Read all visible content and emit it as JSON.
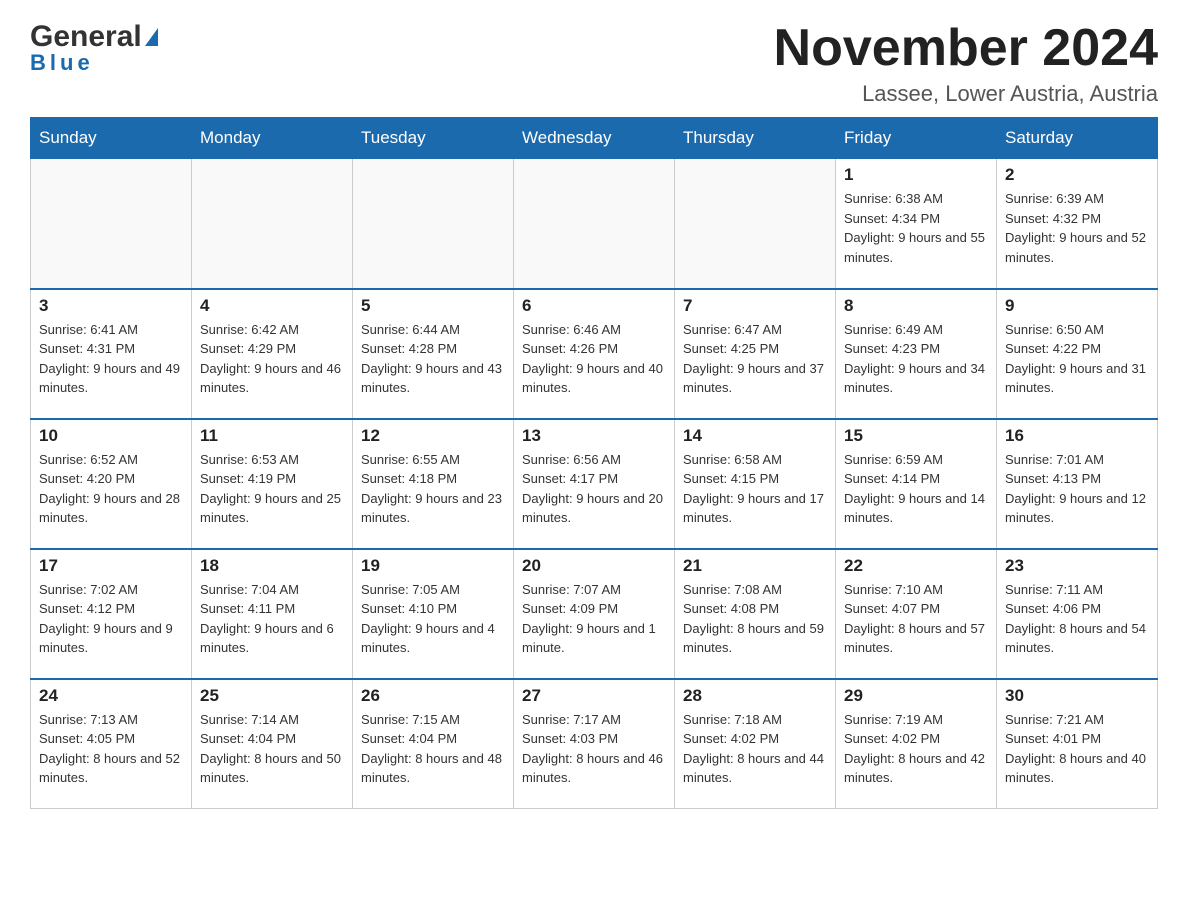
{
  "logo": {
    "general": "General",
    "blue": "Blue"
  },
  "header": {
    "month_year": "November 2024",
    "location": "Lassee, Lower Austria, Austria"
  },
  "weekdays": [
    "Sunday",
    "Monday",
    "Tuesday",
    "Wednesday",
    "Thursday",
    "Friday",
    "Saturday"
  ],
  "weeks": [
    [
      {
        "day": "",
        "info": ""
      },
      {
        "day": "",
        "info": ""
      },
      {
        "day": "",
        "info": ""
      },
      {
        "day": "",
        "info": ""
      },
      {
        "day": "",
        "info": ""
      },
      {
        "day": "1",
        "info": "Sunrise: 6:38 AM\nSunset: 4:34 PM\nDaylight: 9 hours and 55 minutes."
      },
      {
        "day": "2",
        "info": "Sunrise: 6:39 AM\nSunset: 4:32 PM\nDaylight: 9 hours and 52 minutes."
      }
    ],
    [
      {
        "day": "3",
        "info": "Sunrise: 6:41 AM\nSunset: 4:31 PM\nDaylight: 9 hours and 49 minutes."
      },
      {
        "day": "4",
        "info": "Sunrise: 6:42 AM\nSunset: 4:29 PM\nDaylight: 9 hours and 46 minutes."
      },
      {
        "day": "5",
        "info": "Sunrise: 6:44 AM\nSunset: 4:28 PM\nDaylight: 9 hours and 43 minutes."
      },
      {
        "day": "6",
        "info": "Sunrise: 6:46 AM\nSunset: 4:26 PM\nDaylight: 9 hours and 40 minutes."
      },
      {
        "day": "7",
        "info": "Sunrise: 6:47 AM\nSunset: 4:25 PM\nDaylight: 9 hours and 37 minutes."
      },
      {
        "day": "8",
        "info": "Sunrise: 6:49 AM\nSunset: 4:23 PM\nDaylight: 9 hours and 34 minutes."
      },
      {
        "day": "9",
        "info": "Sunrise: 6:50 AM\nSunset: 4:22 PM\nDaylight: 9 hours and 31 minutes."
      }
    ],
    [
      {
        "day": "10",
        "info": "Sunrise: 6:52 AM\nSunset: 4:20 PM\nDaylight: 9 hours and 28 minutes."
      },
      {
        "day": "11",
        "info": "Sunrise: 6:53 AM\nSunset: 4:19 PM\nDaylight: 9 hours and 25 minutes."
      },
      {
        "day": "12",
        "info": "Sunrise: 6:55 AM\nSunset: 4:18 PM\nDaylight: 9 hours and 23 minutes."
      },
      {
        "day": "13",
        "info": "Sunrise: 6:56 AM\nSunset: 4:17 PM\nDaylight: 9 hours and 20 minutes."
      },
      {
        "day": "14",
        "info": "Sunrise: 6:58 AM\nSunset: 4:15 PM\nDaylight: 9 hours and 17 minutes."
      },
      {
        "day": "15",
        "info": "Sunrise: 6:59 AM\nSunset: 4:14 PM\nDaylight: 9 hours and 14 minutes."
      },
      {
        "day": "16",
        "info": "Sunrise: 7:01 AM\nSunset: 4:13 PM\nDaylight: 9 hours and 12 minutes."
      }
    ],
    [
      {
        "day": "17",
        "info": "Sunrise: 7:02 AM\nSunset: 4:12 PM\nDaylight: 9 hours and 9 minutes."
      },
      {
        "day": "18",
        "info": "Sunrise: 7:04 AM\nSunset: 4:11 PM\nDaylight: 9 hours and 6 minutes."
      },
      {
        "day": "19",
        "info": "Sunrise: 7:05 AM\nSunset: 4:10 PM\nDaylight: 9 hours and 4 minutes."
      },
      {
        "day": "20",
        "info": "Sunrise: 7:07 AM\nSunset: 4:09 PM\nDaylight: 9 hours and 1 minute."
      },
      {
        "day": "21",
        "info": "Sunrise: 7:08 AM\nSunset: 4:08 PM\nDaylight: 8 hours and 59 minutes."
      },
      {
        "day": "22",
        "info": "Sunrise: 7:10 AM\nSunset: 4:07 PM\nDaylight: 8 hours and 57 minutes."
      },
      {
        "day": "23",
        "info": "Sunrise: 7:11 AM\nSunset: 4:06 PM\nDaylight: 8 hours and 54 minutes."
      }
    ],
    [
      {
        "day": "24",
        "info": "Sunrise: 7:13 AM\nSunset: 4:05 PM\nDaylight: 8 hours and 52 minutes."
      },
      {
        "day": "25",
        "info": "Sunrise: 7:14 AM\nSunset: 4:04 PM\nDaylight: 8 hours and 50 minutes."
      },
      {
        "day": "26",
        "info": "Sunrise: 7:15 AM\nSunset: 4:04 PM\nDaylight: 8 hours and 48 minutes."
      },
      {
        "day": "27",
        "info": "Sunrise: 7:17 AM\nSunset: 4:03 PM\nDaylight: 8 hours and 46 minutes."
      },
      {
        "day": "28",
        "info": "Sunrise: 7:18 AM\nSunset: 4:02 PM\nDaylight: 8 hours and 44 minutes."
      },
      {
        "day": "29",
        "info": "Sunrise: 7:19 AM\nSunset: 4:02 PM\nDaylight: 8 hours and 42 minutes."
      },
      {
        "day": "30",
        "info": "Sunrise: 7:21 AM\nSunset: 4:01 PM\nDaylight: 8 hours and 40 minutes."
      }
    ]
  ]
}
